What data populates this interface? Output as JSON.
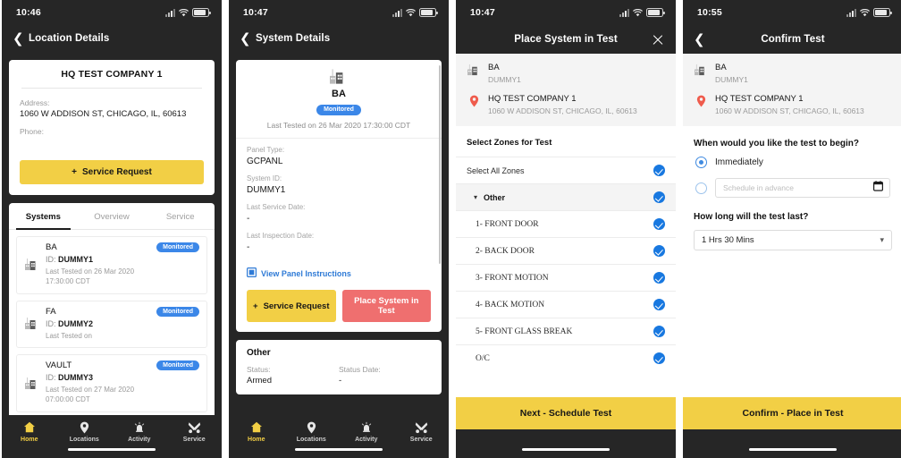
{
  "colors": {
    "brand_yellow": "#f2cf45",
    "danger_red": "#ef6f6f",
    "badge_blue": "#3b87e8",
    "check_blue": "#1878e0",
    "dark_chrome": "#262626",
    "pin_red": "#ef5b4c"
  },
  "screen1": {
    "status": {
      "time": "10:46"
    },
    "nav": {
      "back_icon": "chevron-left-icon",
      "title": "Location Details"
    },
    "location_card": {
      "title": "HQ TEST COMPANY 1",
      "address_label": "Address:",
      "address_value": "1060 W ADDISON ST, CHICAGO, IL, 60613",
      "phone_label": "Phone:",
      "phone_value": "",
      "service_request_label": "Service Request",
      "service_request_icon": "plus-icon"
    },
    "tabs": [
      {
        "label": "Systems",
        "active": true
      },
      {
        "label": "Overview",
        "active": false
      },
      {
        "label": "Service",
        "active": false
      }
    ],
    "systems": [
      {
        "icon": "building-icon",
        "name": "BA",
        "badge": "Monitored",
        "id_label": "ID:",
        "id_value": "DUMMY1",
        "last_tested": "Last Tested on 26 Mar 2020\n17:30:00 CDT"
      },
      {
        "icon": "building-icon",
        "name": "FA",
        "badge": "Monitored",
        "id_label": "ID:",
        "id_value": "DUMMY2",
        "last_tested": "Last Tested on"
      },
      {
        "icon": "building-icon",
        "name": "VAULT",
        "badge": "Monitored",
        "id_label": "ID:",
        "id_value": "DUMMY3",
        "last_tested": "Last Tested on 27 Mar 2020\n07:00:00 CDT"
      }
    ],
    "tabbar": [
      {
        "label": "Home",
        "icon": "home-icon",
        "active": true
      },
      {
        "label": "Locations",
        "icon": "map-pin-icon",
        "active": false
      },
      {
        "label": "Activity",
        "icon": "alarm-bell-icon",
        "active": false
      },
      {
        "label": "Service",
        "icon": "tools-icon",
        "active": false
      }
    ]
  },
  "screen2": {
    "status": {
      "time": "10:47"
    },
    "nav": {
      "back_icon": "chevron-left-icon",
      "title": "System Details"
    },
    "system_card": {
      "icon": "building-icon",
      "name": "BA",
      "badge": "Monitored",
      "last_tested": "Last Tested on 26 Mar 2020 17:30:00 CDT",
      "fields": [
        {
          "label": "Panel Type:",
          "value": "GCPANL"
        },
        {
          "label": "System ID:",
          "value": "DUMMY1"
        },
        {
          "label": "Last Service Date:",
          "value": "-"
        },
        {
          "label": "Last Inspection Date:",
          "value": "-"
        }
      ],
      "panel_link": {
        "icon": "document-icon",
        "label": "View Panel Instructions"
      },
      "service_request_label": "Service Request",
      "service_request_icon": "plus-icon",
      "place_in_test_label": "Place System in Test"
    },
    "other_card": {
      "title": "Other",
      "status_label": "Status:",
      "status_value": "Armed",
      "status_date_label": "Status Date:",
      "status_date_value": "-"
    },
    "tabbar": [
      {
        "label": "Home",
        "icon": "home-icon",
        "active": true
      },
      {
        "label": "Locations",
        "icon": "map-pin-icon",
        "active": false
      },
      {
        "label": "Activity",
        "icon": "alarm-bell-icon",
        "active": false
      },
      {
        "label": "Service",
        "icon": "tools-icon",
        "active": false
      }
    ]
  },
  "screen3": {
    "status": {
      "time": "10:47"
    },
    "nav": {
      "title": "Place System in Test",
      "close_icon": "close-icon"
    },
    "context": {
      "system_icon": "building-icon",
      "system_name": "BA",
      "system_id": "DUMMY1",
      "location_icon": "map-pin-icon",
      "location_name": "HQ TEST COMPANY 1",
      "location_address": "1060 W ADDISON ST, CHICAGO, IL, 60613"
    },
    "section_title": "Select Zones for Test",
    "select_all": {
      "label": "Select All Zones",
      "checked": true
    },
    "group": {
      "label": "Other",
      "chevron": "chevron-down-icon",
      "checked": true
    },
    "zones": [
      {
        "label": "1- FRONT DOOR",
        "checked": true
      },
      {
        "label": "2- BACK DOOR",
        "checked": true
      },
      {
        "label": "3- FRONT MOTION",
        "checked": true
      },
      {
        "label": "4- BACK MOTION",
        "checked": true
      },
      {
        "label": "5- FRONT GLASS BREAK",
        "checked": true
      },
      {
        "label": "O/C",
        "checked": true
      }
    ],
    "cta_label": "Next - Schedule Test"
  },
  "screen4": {
    "status": {
      "time": "10:55"
    },
    "nav": {
      "back_icon": "chevron-left-icon",
      "title": "Confirm Test"
    },
    "context": {
      "system_icon": "building-icon",
      "system_name": "BA",
      "system_id": "DUMMY1",
      "location_icon": "map-pin-icon",
      "location_name": "HQ TEST COMPANY 1",
      "location_address": "1060 W ADDISON ST, CHICAGO, IL, 60613"
    },
    "begin_question": "When would you like the test to begin?",
    "option_immediately": {
      "label": "Immediately",
      "selected": true
    },
    "option_schedule": {
      "placeholder": "Schedule in advance",
      "value": "",
      "selected": false,
      "icon": "calendar-icon"
    },
    "duration_question": "How long will the test last?",
    "duration_value": "1 Hrs 30 Mins",
    "duration_chevron": "chevron-down-icon",
    "cta_label": "Confirm - Place in Test"
  }
}
